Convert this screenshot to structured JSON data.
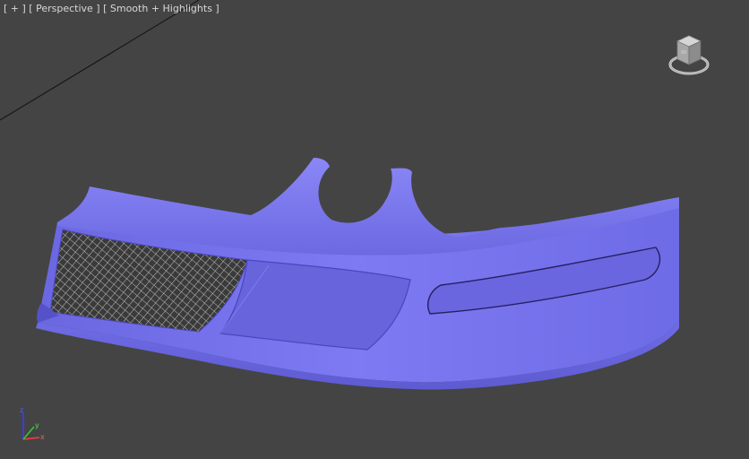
{
  "viewport": {
    "menu_label": "[ + ]",
    "view_label": "[ Perspective ]",
    "shading_label": "[ Smooth + Highlights ]"
  },
  "axis": {
    "x": "x",
    "y": "y",
    "z": "z"
  },
  "colors": {
    "background": "#444444",
    "model": "#7b78f0",
    "label_text": "#d8d8d8"
  },
  "icons": [
    "viewcube-icon",
    "axis-tripod-icon"
  ]
}
